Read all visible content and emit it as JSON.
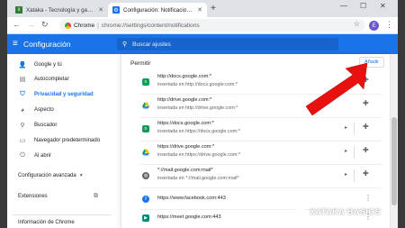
{
  "browser": {
    "tabs": [
      {
        "title": "Xataka - Tecnología y gadgets, ...",
        "active": false,
        "favicon": "xataka-favicon"
      },
      {
        "title": "Configuración: Notificaciones",
        "active": true,
        "favicon": "gear-icon"
      }
    ],
    "new_tab": "+",
    "omnibox": {
      "site": "Chrome",
      "separator": "|",
      "url": "chrome://settings/content/notifications"
    },
    "avatar_initial": "E"
  },
  "settings": {
    "header_title": "Configuración",
    "search_placeholder": "Buscar ajustes",
    "sidebar": {
      "items": [
        {
          "label": "Google y tú",
          "icon": "person-icon",
          "active": false
        },
        {
          "label": "Autocompletar",
          "icon": "clipboard-icon",
          "active": false
        },
        {
          "label": "Privacidad y seguridad",
          "icon": "shield-icon",
          "active": true
        },
        {
          "label": "Aspecto",
          "icon": "palette-icon",
          "active": false
        },
        {
          "label": "Buscador",
          "icon": "search-icon",
          "active": false
        },
        {
          "label": "Navegador predeterminado",
          "icon": "browser-icon",
          "active": false
        },
        {
          "label": "Al abrir",
          "icon": "power-icon",
          "active": false
        }
      ],
      "advanced": "Configuración avanzada",
      "extensions": "Extensiones",
      "about": "Información de Chrome"
    },
    "allow_section": {
      "heading": "Permitir",
      "add_button": "Añadir",
      "sites": [
        {
          "line1": "http://docs.google.com:*",
          "line2": "insertada en http://docs.google.com:*",
          "icon": "docs-icon",
          "color": "#0f9d58",
          "action": "puzzle"
        },
        {
          "line1": "http://drive.google.com:*",
          "line2": "insertada en http://drive.google.com:*",
          "icon": "drive-icon",
          "color": "#4285f4",
          "action": "puzzle"
        },
        {
          "line1": "https://docs.google.com:*",
          "line2": "insertada en https://docs.google.com:*",
          "icon": "docs-icon",
          "color": "#0f9d58",
          "action": "puzzle"
        },
        {
          "line1": "https://drive.google.com:*",
          "line2": "insertada en https://drive.google.com:*",
          "icon": "drive-icon",
          "color": "#4285f4",
          "action": "puzzle"
        },
        {
          "line1": "*://mail.google.com:mail*",
          "line2": "insertada en *://mail.google.com:mail*",
          "icon": "globe-icon",
          "color": "#5f6368",
          "action": "puzzle"
        },
        {
          "line1": "https://www.facebook.com:443",
          "line2": "",
          "icon": "facebook-icon",
          "color": "#1877f2",
          "action": "more"
        },
        {
          "line1": "https://meet.google.com:443",
          "line2": "",
          "icon": "meet-icon",
          "color": "#00897b",
          "action": "more"
        }
      ]
    }
  },
  "watermark": "XATAKA BASICS"
}
